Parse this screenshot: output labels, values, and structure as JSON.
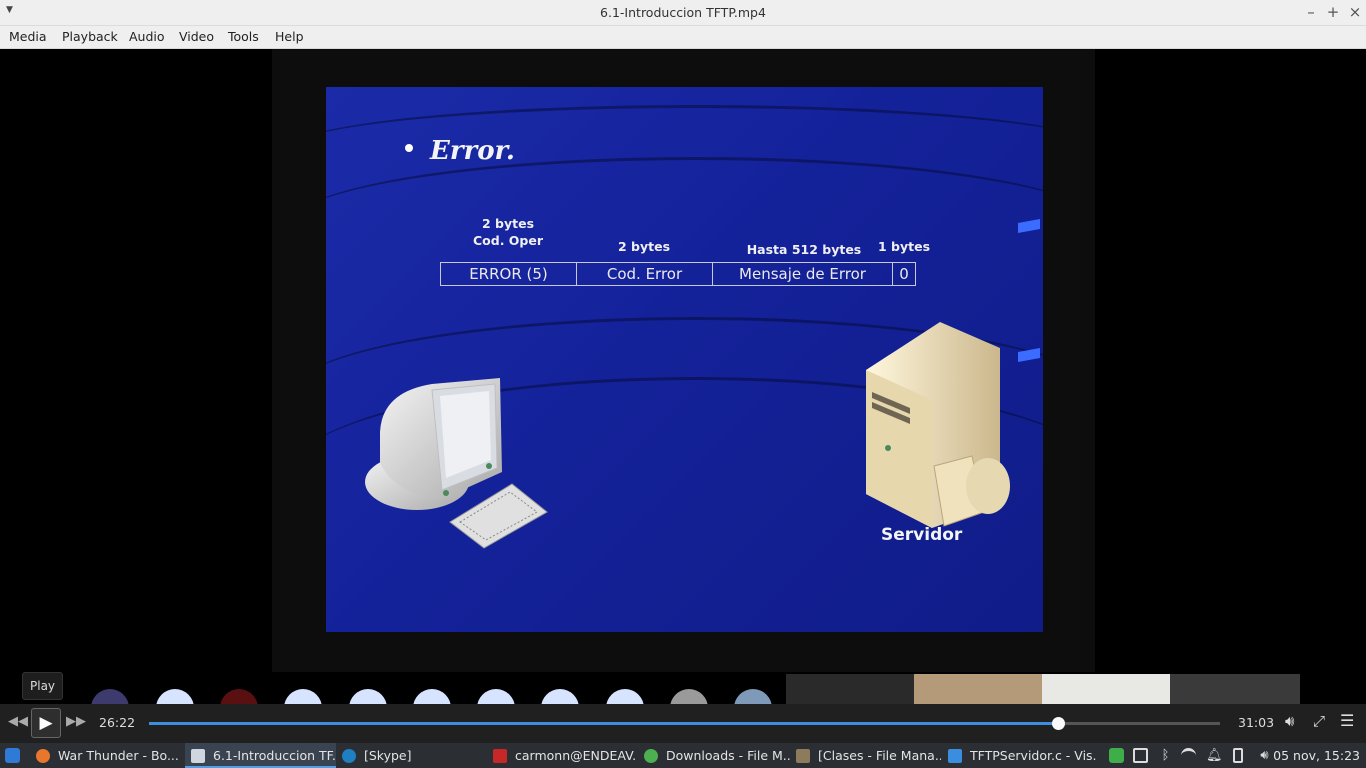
{
  "window": {
    "title": "6.1-Introduccion TFTP.mp4",
    "controls": {
      "minimize": "–",
      "maximize": "+",
      "close": "×"
    }
  },
  "menu": [
    "Media",
    "Playback",
    "Audio",
    "Video",
    "Tools",
    "Help"
  ],
  "slide": {
    "title": "Error.",
    "packet_labels": {
      "opcode_size": "2 bytes",
      "opcode_name": "Cod. Oper",
      "errcode_size": "2 bytes",
      "message_size": "Hasta 512 bytes",
      "terminator_size": "1 bytes"
    },
    "packet_fields": [
      "ERROR (5)",
      "Cod. Error",
      "Mensaje de Error",
      "0"
    ],
    "server_label": "Servidor"
  },
  "player": {
    "tooltip": "Play",
    "current_time": "26:22",
    "total_time": "31:03",
    "progress": 0.849
  },
  "taskbar": {
    "tasks": [
      {
        "label": "War Thunder - Bo...",
        "icon": "firefox-icon",
        "color": "#e8762c"
      },
      {
        "label": "6.1-Introduccion TF...",
        "icon": "media-player-icon",
        "color": "#cfd6e0",
        "active": true
      },
      {
        "label": "[Skype]",
        "icon": "skype-icon",
        "color": "#1e7fc1"
      },
      {
        "label": "carmonn@ENDEAV...",
        "icon": "terminal-icon",
        "color": "#c62828"
      },
      {
        "label": "Downloads - File M...",
        "icon": "download-icon",
        "color": "#4caf50"
      },
      {
        "label": "[Clases - File Mana...",
        "icon": "folder-icon",
        "color": "#8d7b5c"
      },
      {
        "label": "TFTPServidor.c - Vis...",
        "icon": "vscode-icon",
        "color": "#3b8de0"
      }
    ],
    "clock": "05 nov, 15:23"
  }
}
